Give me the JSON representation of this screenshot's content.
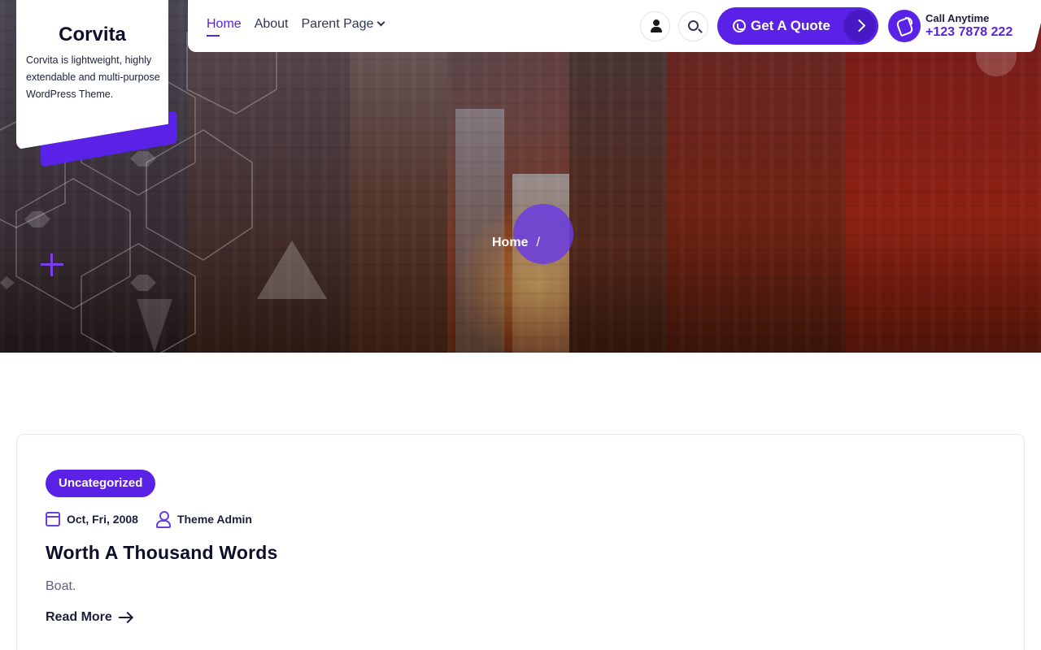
{
  "brand": {
    "title": "Corvita",
    "description": "Corvita is lightweight, highly extendable and multi-purpose WordPress Theme."
  },
  "nav": {
    "items": [
      {
        "label": "Home",
        "active": true
      },
      {
        "label": "About",
        "active": false
      },
      {
        "label": "Parent Page",
        "active": false
      }
    ],
    "quote_label": "Get A Quote",
    "call_label": "Call Anytime",
    "call_number": "+123 7878 222",
    "icons": {
      "user": "user-icon",
      "search": "search-icon",
      "whatsapp": "whatsapp-icon",
      "phone": "phone-icon"
    }
  },
  "hero": {
    "breadcrumb": {
      "home": "Home",
      "separator": "/"
    }
  },
  "post": {
    "category": "Uncategorized",
    "date": "Oct, Fri, 2008",
    "author": "Theme Admin",
    "title": "Worth A Thousand Words",
    "excerpt": "Boat.",
    "read_more": "Read More"
  },
  "colors": {
    "accent": "#5a22e6",
    "text_dark": "#0b0f2a",
    "muted": "#5b6080"
  }
}
